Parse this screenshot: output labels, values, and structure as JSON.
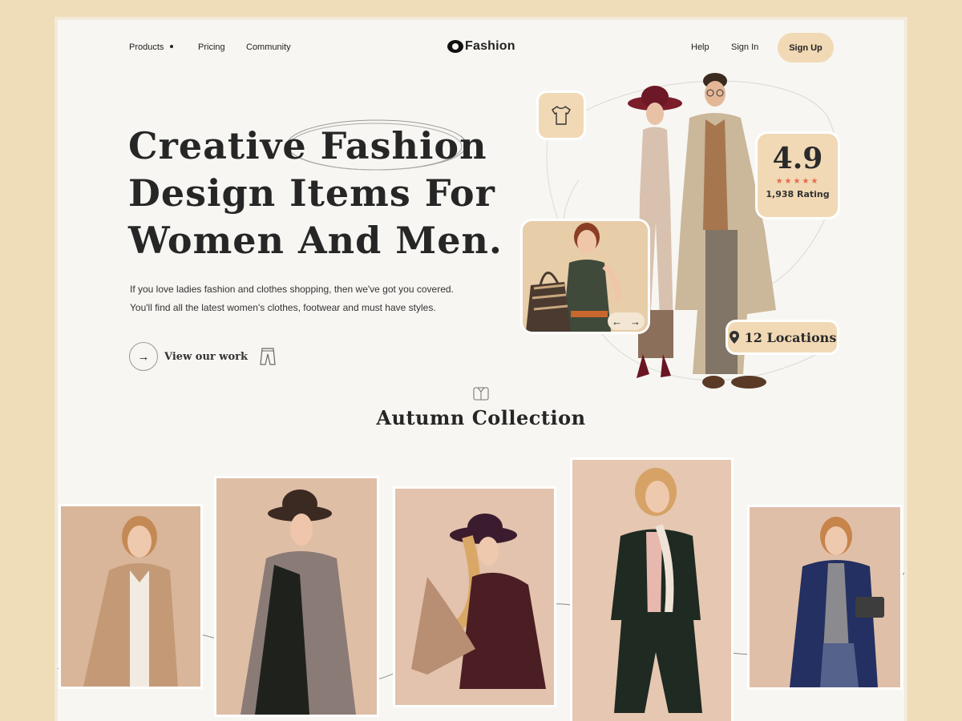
{
  "nav": {
    "products": "Products",
    "pricing": "Pricing",
    "community": "Community",
    "brand": "Fashion",
    "help": "Help",
    "sign_in": "Sign In",
    "sign_up": "Sign Up"
  },
  "hero": {
    "title_lines": [
      "Creative Fashion",
      "Design Items For",
      "Women And Men."
    ],
    "description_lines": [
      "If you love ladies fashion and clothes shopping, then we've got you covered.",
      "You'll find all the latest women's clothes, footwear and must have styles."
    ],
    "cta_label": "View our work",
    "cta_icon": "arrow-right-icon"
  },
  "stats": {
    "rating_value": "4.9",
    "stars": "★★★★★",
    "rating_count": "1,938 Rating",
    "locations": "12 Locations"
  },
  "slider": {
    "prev": "←",
    "next": "→"
  },
  "collection": {
    "title": "Autumn Collection",
    "icon": "shirt-box-icon",
    "items": [
      {
        "palette": "#d9b59a",
        "outfit": "#c49a76"
      },
      {
        "palette": "#dfbea6",
        "outfit": "#1f211d"
      },
      {
        "palette": "#e3c3ad",
        "outfit": "#4b1e24"
      },
      {
        "palette": "#e6c7b1",
        "outfit": "#1e2a22"
      },
      {
        "palette": "#e0bfa8",
        "outfit": "#233061"
      }
    ]
  },
  "colors": {
    "background": "#efdcb8",
    "page": "#f7f6f2",
    "accent": "#f1d9b5",
    "star": "#e8694a",
    "text": "#262626"
  }
}
